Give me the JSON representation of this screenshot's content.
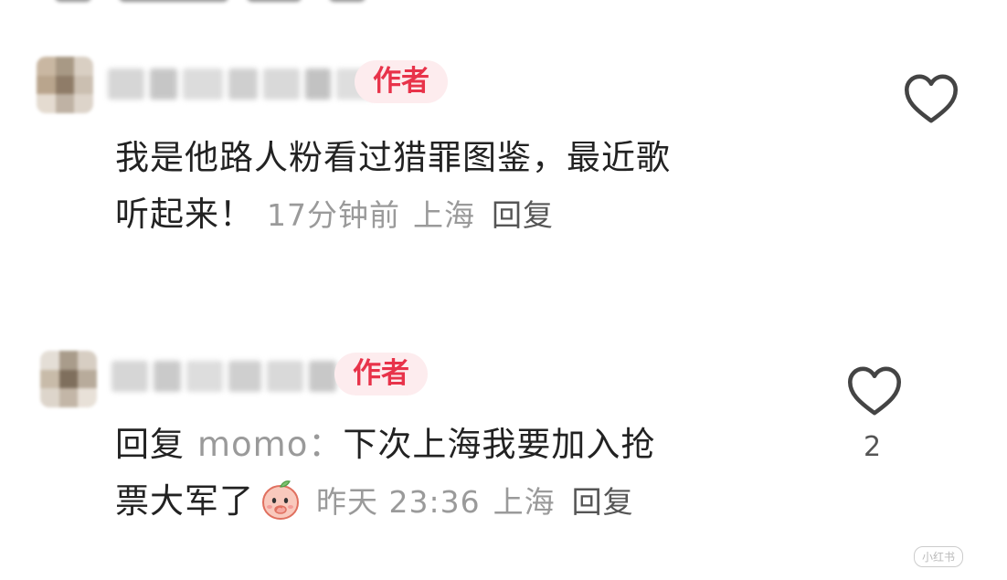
{
  "comments": [
    {
      "badge": "作者",
      "text_line1": "我是他路人粉看过猎罪图鉴，最近歌",
      "text_line2": "听起来！",
      "time": "17分钟前",
      "location": "上海",
      "reply_label": "回复",
      "likes": ""
    },
    {
      "badge": "作者",
      "reply_prefix": "回复",
      "mention": "momo：",
      "text_line1": "下次上海我要加入抢",
      "text_line2": "票大军了",
      "time": "昨天 23:36",
      "location": "上海",
      "reply_label": "回复",
      "likes": "2"
    }
  ],
  "watermark": "小红书",
  "icons": {
    "like": "heart-outline-icon",
    "emoji": "peach-face-icon"
  },
  "colors": {
    "badge_text": "#e8334a",
    "badge_bg": "#fdecee",
    "meta": "#9a9a9a"
  }
}
